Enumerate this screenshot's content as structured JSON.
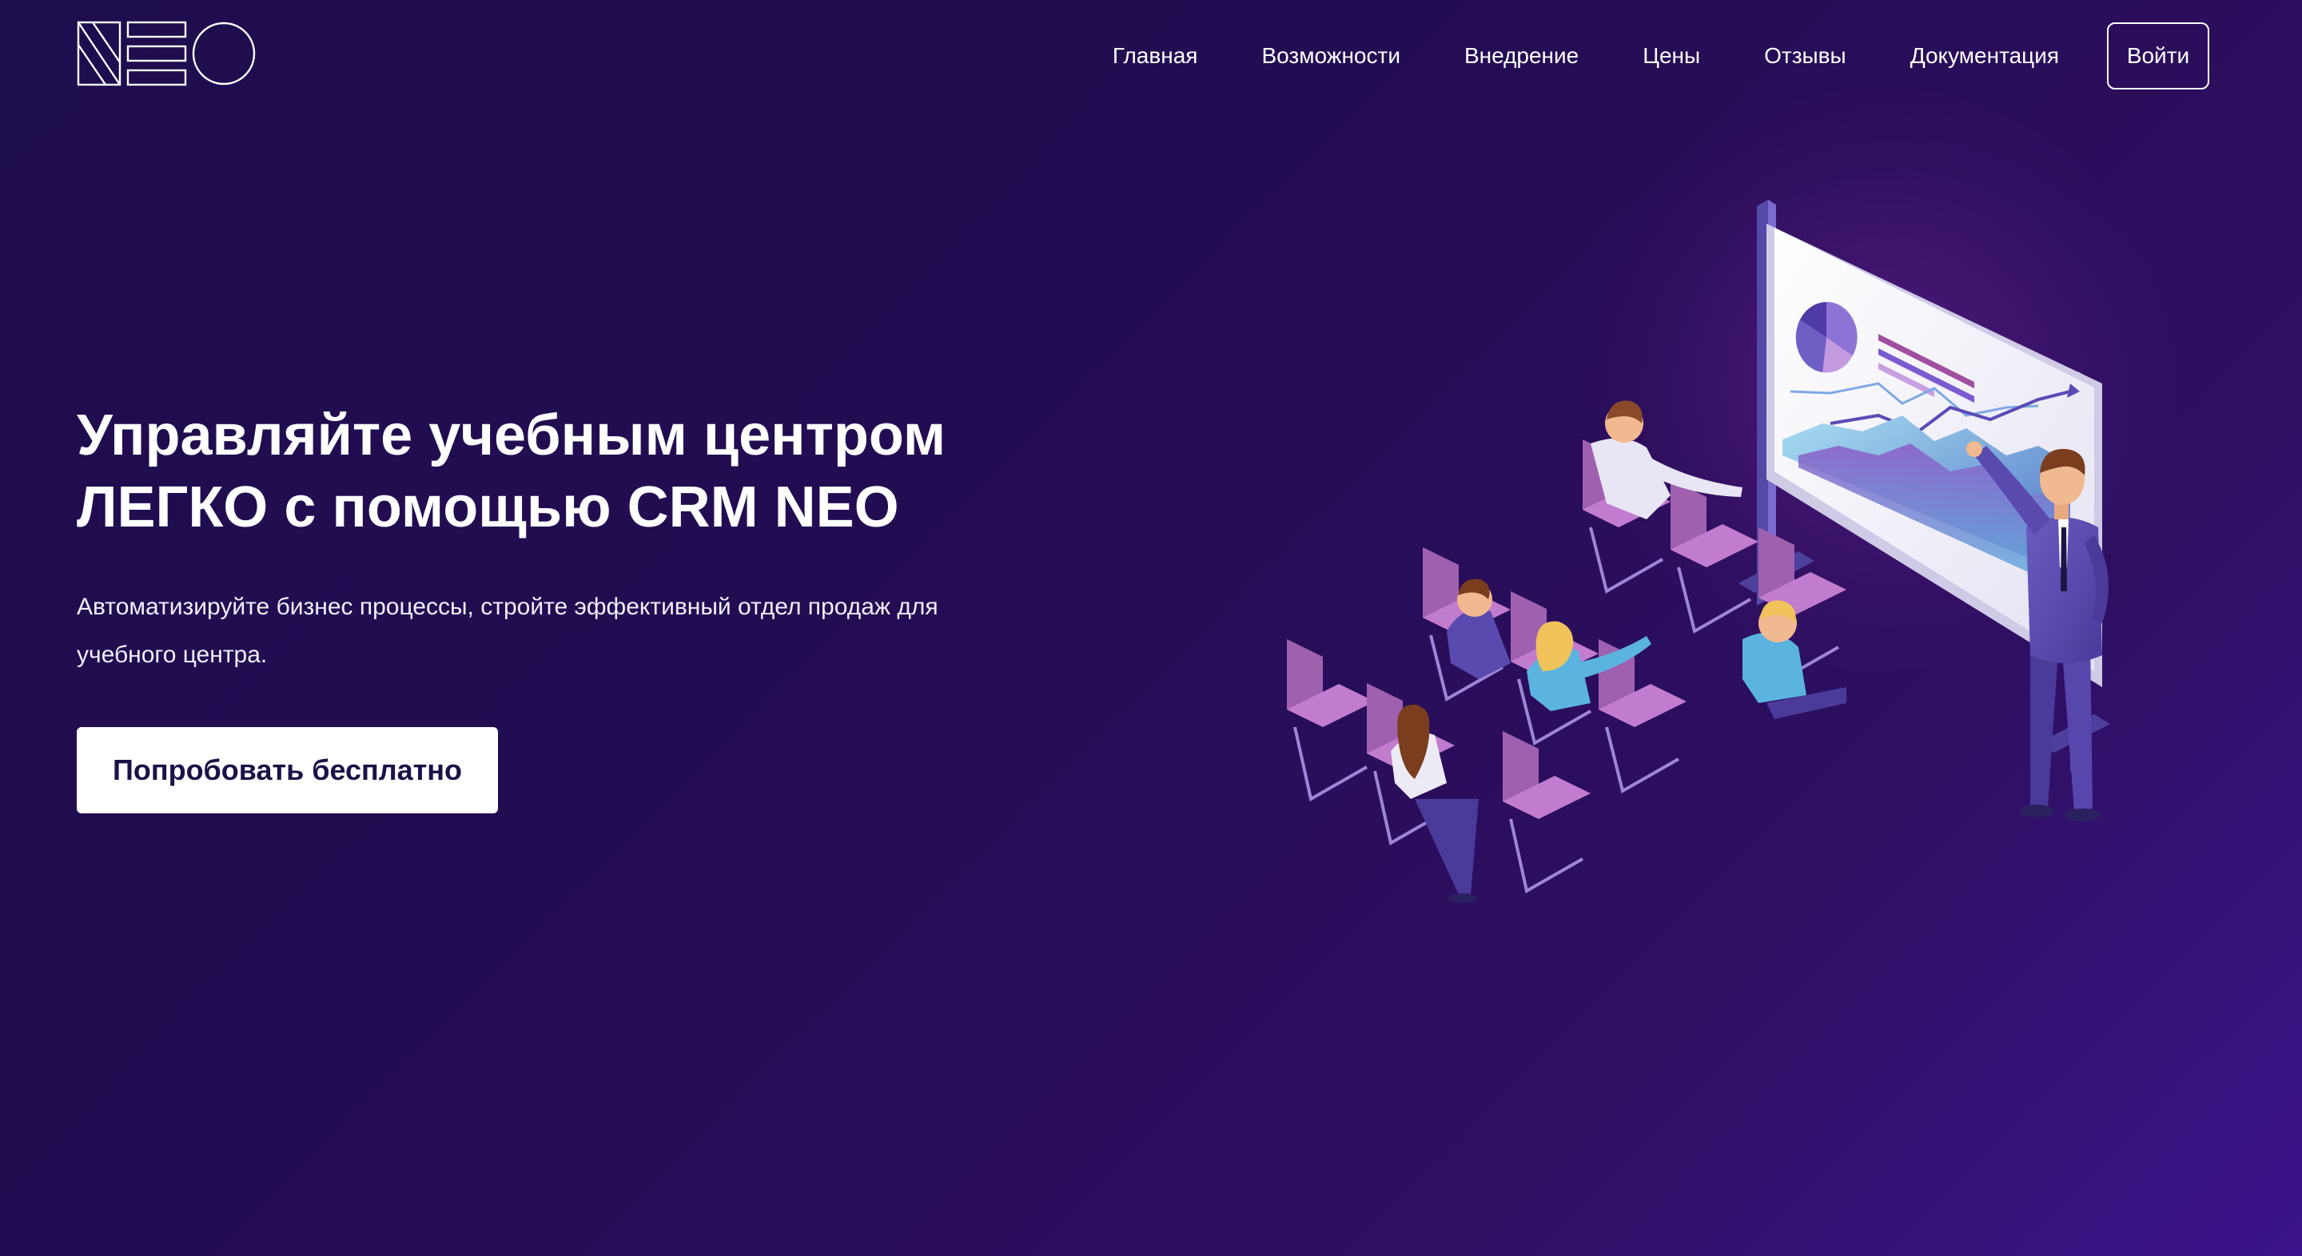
{
  "header": {
    "logo_text": "NEO",
    "nav": [
      {
        "label": "Главная"
      },
      {
        "label": "Возможности"
      },
      {
        "label": "Внедрение"
      },
      {
        "label": "Цены"
      },
      {
        "label": "Отзывы"
      },
      {
        "label": "Документация"
      }
    ],
    "login_label": "Войти"
  },
  "hero": {
    "title_line1": "Управляйте учебным центром",
    "title_line2": "ЛЕГКО с помощью CRM NEO",
    "subtitle_line1": "Автоматизируйте бизнес процессы, стройте эффективный отдел продаж для",
    "subtitle_line2": "учебного центра.",
    "cta_label": "Попробовать бесплатно"
  },
  "illustration": {
    "icon": "presentation-illustration"
  },
  "colors": {
    "background_start": "#1e0d4e",
    "background_end": "#3c138a",
    "cta_text": "#1d1147",
    "chair": "#b56fc4"
  }
}
